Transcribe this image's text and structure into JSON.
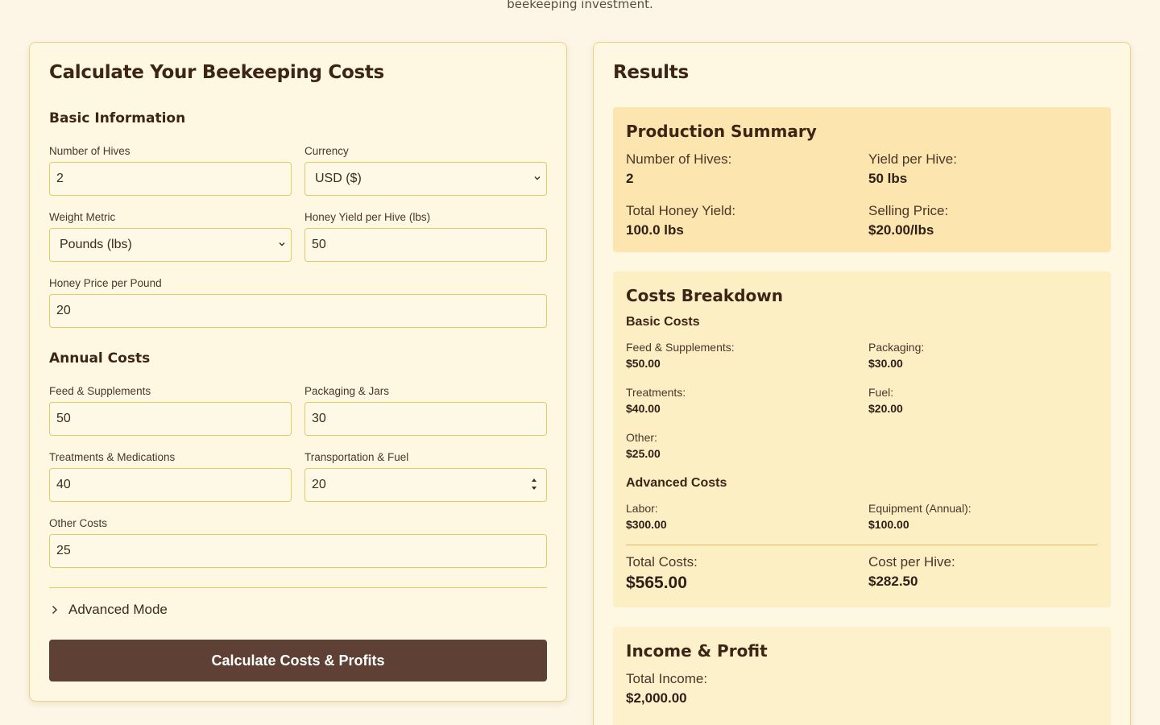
{
  "intro_text": "beekeeping investment.",
  "calculator": {
    "title": "Calculate Your Beekeeping Costs",
    "basic_title": "Basic Information",
    "hives_label": "Number of Hives",
    "hives_value": "2",
    "currency_label": "Currency",
    "currency_value": "USD ($)",
    "weight_label": "Weight Metric",
    "weight_value": "Pounds (lbs)",
    "yield_label": "Honey Yield per Hive (lbs)",
    "yield_value": "50",
    "price_label": "Honey Price per Pound",
    "price_value": "20",
    "annual_title": "Annual Costs",
    "feed_label": "Feed & Supplements",
    "feed_value": "50",
    "packaging_label": "Packaging & Jars",
    "packaging_value": "30",
    "treatments_label": "Treatments & Medications",
    "treatments_value": "40",
    "transport_label": "Transportation & Fuel",
    "transport_value": "20",
    "other_label": "Other Costs",
    "other_value": "25",
    "advanced_mode_label": "Advanced Mode",
    "calculate_button": "Calculate Costs & Profits"
  },
  "results": {
    "title": "Results",
    "summary": {
      "title": "Production Summary",
      "hives_label": "Number of Hives:",
      "hives_value": "2",
      "yield_label": "Yield per Hive:",
      "yield_value": "50 lbs",
      "total_label": "Total Honey Yield:",
      "total_value": "100.0 lbs",
      "price_label": "Selling Price:",
      "price_value": "$20.00/lbs"
    },
    "costs": {
      "title": "Costs Breakdown",
      "basic_title": "Basic Costs",
      "feed_label": "Feed & Supplements:",
      "feed_value": "$50.00",
      "packaging_label": "Packaging:",
      "packaging_value": "$30.00",
      "treatments_label": "Treatments:",
      "treatments_value": "$40.00",
      "fuel_label": "Fuel:",
      "fuel_value": "$20.00",
      "other_label": "Other:",
      "other_value": "$25.00",
      "advanced_title": "Advanced Costs",
      "labor_label": "Labor:",
      "labor_value": "$300.00",
      "equipment_label": "Equipment (Annual):",
      "equipment_value": "$100.00",
      "total_label": "Total Costs:",
      "total_value": "$565.00",
      "per_hive_label": "Cost per Hive:",
      "per_hive_value": "$282.50"
    },
    "income": {
      "title": "Income & Profit",
      "total_income_label": "Total Income:",
      "total_income_value": "$2,000.00"
    }
  },
  "colors": {
    "background": "#fdf6e6",
    "panel_border": "#ecd27e",
    "button": "#5e4035",
    "summary_card": "#fce5ae",
    "costs_card": "#fdefc4"
  }
}
